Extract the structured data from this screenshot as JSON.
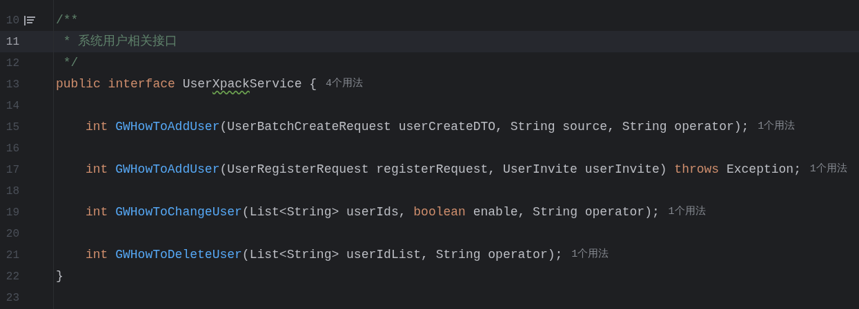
{
  "editor": {
    "lines": [
      {
        "number": "10",
        "current": false,
        "doc_toggle": true,
        "tokens": [
          {
            "kind": "comment",
            "text": "/**"
          }
        ]
      },
      {
        "number": "11",
        "current": true,
        "tokens": [
          {
            "kind": "comment",
            "text": " * 系统用户相关接口"
          }
        ]
      },
      {
        "number": "12",
        "current": false,
        "tokens": [
          {
            "kind": "comment",
            "text": " */"
          }
        ]
      },
      {
        "number": "13",
        "current": false,
        "tokens": [
          {
            "kind": "keyword",
            "text": "public"
          },
          {
            "kind": "keyword",
            "text": "interface"
          },
          {
            "kind": "plain",
            "text": "User"
          },
          {
            "kind": "typo",
            "text": "Xpack"
          },
          {
            "kind": "plain",
            "text": "Service {"
          }
        ],
        "hint": "4个用法"
      },
      {
        "number": "14",
        "current": false
      },
      {
        "number": "15",
        "current": false,
        "indented": true,
        "tokens": [
          {
            "kind": "keyword",
            "text": "int"
          },
          {
            "kind": "method",
            "text": "GWHowToAddUser"
          },
          {
            "kind": "plain",
            "text": "(UserBatchCreateRequest userCreateDTO, String source, String operator);"
          }
        ],
        "hint": "1个用法"
      },
      {
        "number": "16",
        "current": false
      },
      {
        "number": "17",
        "current": false,
        "indented": true,
        "tokens": [
          {
            "kind": "keyword",
            "text": "int"
          },
          {
            "kind": "method",
            "text": "GWHowToAddUser"
          },
          {
            "kind": "plain",
            "text": "(UserRegisterRequest registerRequest, UserInvite userInvite)"
          },
          {
            "kind": "keyword",
            "text": "throws"
          },
          {
            "kind": "plain",
            "text": "Exception;"
          }
        ],
        "hint": "1个用法"
      },
      {
        "number": "18",
        "current": false
      },
      {
        "number": "19",
        "current": false,
        "indented": true,
        "tokens": [
          {
            "kind": "keyword",
            "text": "int"
          },
          {
            "kind": "method",
            "text": "GWHowToChangeUser"
          },
          {
            "kind": "plain",
            "text": "(List<String> userIds,"
          },
          {
            "kind": "keyword",
            "text": "boolean"
          },
          {
            "kind": "plain",
            "text": "enable, String operator);"
          }
        ],
        "hint": "1个用法"
      },
      {
        "number": "20",
        "current": false
      },
      {
        "number": "21",
        "current": false,
        "indented": true,
        "tokens": [
          {
            "kind": "keyword",
            "text": "int"
          },
          {
            "kind": "method",
            "text": "GWHowToDeleteUser"
          },
          {
            "kind": "plain",
            "text": "(List<String> userIdList, String operator);"
          }
        ],
        "hint": "1个用法"
      },
      {
        "number": "22",
        "current": false,
        "tokens": [
          {
            "kind": "plain",
            "text": "}"
          }
        ]
      },
      {
        "number": "23",
        "current": false
      }
    ]
  }
}
